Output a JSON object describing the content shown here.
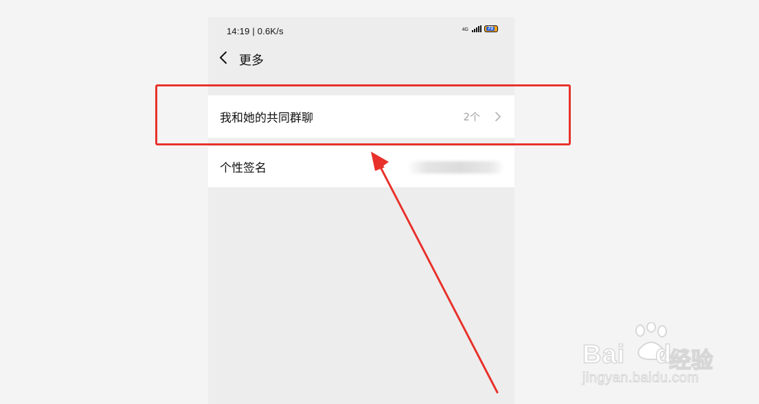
{
  "status_bar": {
    "time_speed": "14:19 | 0.6K/s",
    "network": "4G",
    "battery_level": "73",
    "icons": [
      "signal-icon",
      "battery-icon"
    ]
  },
  "nav": {
    "back_icon": "back-chevron-icon",
    "title": "更多"
  },
  "rows": {
    "common_groups": {
      "label": "我和她的共同群聊",
      "count": "2个",
      "icon": "chevron-right-icon"
    },
    "signature": {
      "label": "个性签名"
    }
  },
  "watermark": {
    "brand": "Bai",
    "brand_du": "du",
    "cn": "经验",
    "url": "jingyan.baidu.com"
  },
  "colors": {
    "annotation_red": "#e8312a",
    "background": "#ededed",
    "row_bg": "#ffffff",
    "secondary_text": "#a3a3a3"
  }
}
